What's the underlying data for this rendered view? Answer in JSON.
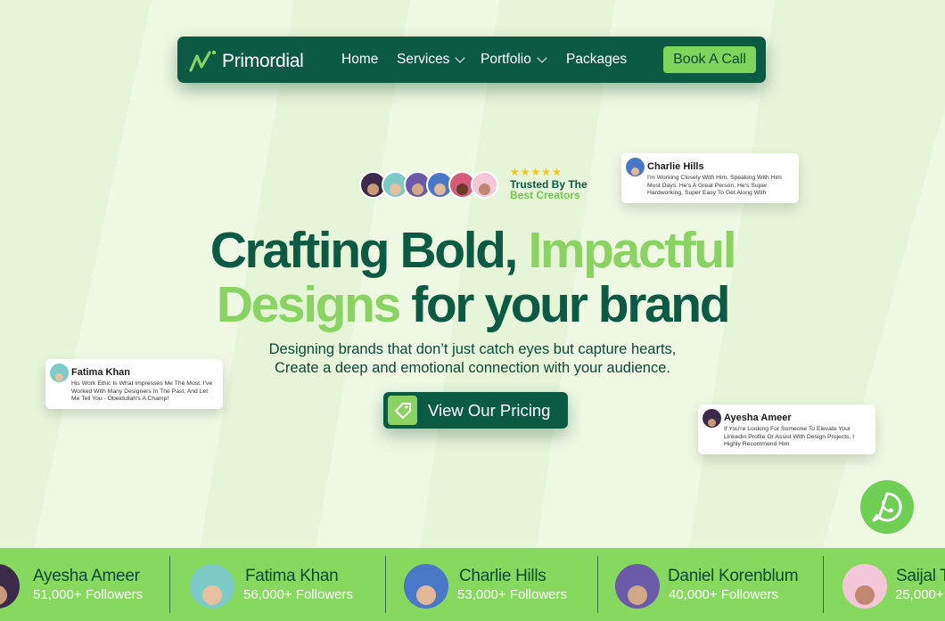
{
  "nav": {
    "brand": "Primordial",
    "items": [
      {
        "label": "Home"
      },
      {
        "label": "Services"
      },
      {
        "label": "Portfolio"
      },
      {
        "label": "Packages"
      }
    ],
    "cta": "Book A Call"
  },
  "trust": {
    "stars": "★★★★★",
    "line1": "Trusted By The",
    "line2": "Best Creators"
  },
  "hero": {
    "line1_dark": "Crafting Bold, ",
    "line1_light": "Impactful",
    "line2_light": "Designs",
    "line2_dark": " for your brand",
    "sub1": "Designing brands that don’t just catch eyes but capture hearts,",
    "sub2": "Create a deep and emotional connection with your audience.",
    "cta": "View Our Pricing"
  },
  "testimonials": [
    {
      "name": "Charlie Hills",
      "quote": "I'm Working Closely With Him, Speaking With Him Most Days. He's A Great Person, He's Super Hardworking, Super Easy To Get Along With"
    },
    {
      "name": "Fatima Khan",
      "quote": "His Work Ethic Is What Impresses Me The Most. I've Worked With Many Designers In The Past, And Let Me Tell You - Obeidullah's A Champ!"
    },
    {
      "name": "Ayesha Ameer",
      "quote": "If You're Looking For Someone To Elevate Your Linkedin Profile Or Assist With Design Projects, I Highly Recommend Him"
    }
  ],
  "creators": [
    {
      "name": "Ayesha Ameer",
      "followers": "51,000+ Followers"
    },
    {
      "name": "Fatima Khan",
      "followers": "56,000+ Followers"
    },
    {
      "name": "Charlie Hills",
      "followers": "53,000+ Followers"
    },
    {
      "name": "Daniel Korenblum",
      "followers": "40,000+ Followers"
    },
    {
      "name": "Saijal T",
      "followers": "25,000+"
    }
  ],
  "icons": {
    "logo": "primordial-logo-icon",
    "tag": "price-tag-icon",
    "chat": "whatsapp-icon"
  },
  "colors": {
    "dark_green": "#0c5a43",
    "light_green": "#8ad363",
    "strip_green": "#86d95e",
    "background": "#eef8e3",
    "star": "#f5c518"
  }
}
